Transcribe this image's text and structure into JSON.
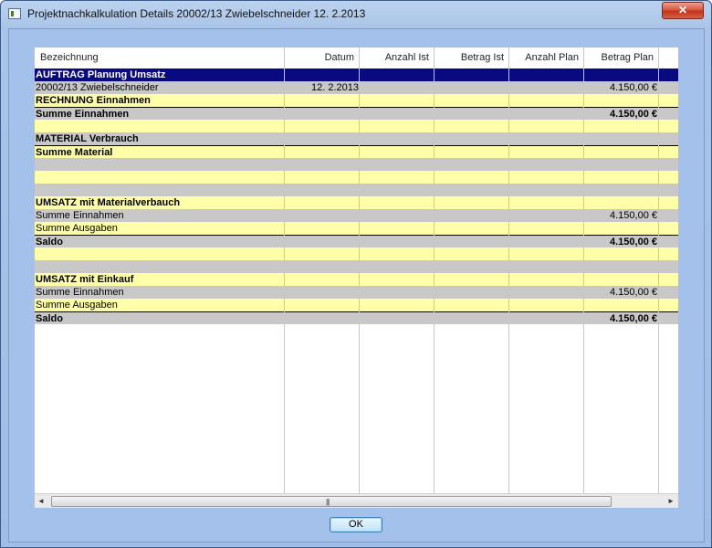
{
  "window": {
    "title": "Projektnachkalkulation Details 20002/13  Zwiebelschneider  12.  2.2013",
    "close_label": "✕",
    "ok_label": "OK"
  },
  "table": {
    "columns": [
      "Bezeichnung",
      "Datum",
      "Anzahl Ist",
      "Betrag Ist",
      "Anzahl Plan",
      "Betrag Plan"
    ],
    "rows": [
      {
        "style": "navy",
        "bold": true,
        "name": "AUFTRAG Planung Umsatz",
        "datum": "",
        "betrag_plan": ""
      },
      {
        "style": "gray",
        "bold": false,
        "name": "20002/13 Zwiebelschneider",
        "datum": "12.  2.2013",
        "betrag_plan": "4.150,00 €"
      },
      {
        "style": "yellow",
        "bold": true,
        "name": "RECHNUNG Einnahmen",
        "datum": "",
        "betrag_plan": ""
      },
      {
        "style": "gray",
        "bold": true,
        "name": "Summe Einnahmen",
        "datum": "",
        "betrag_plan": "4.150,00 €",
        "top_border": true
      },
      {
        "style": "yellow",
        "bold": false,
        "name": "",
        "datum": "",
        "betrag_plan": ""
      },
      {
        "style": "gray",
        "bold": true,
        "name": "MATERIAL Verbrauch",
        "datum": "",
        "betrag_plan": ""
      },
      {
        "style": "yellow",
        "bold": true,
        "name": "Summe Material",
        "datum": "",
        "betrag_plan": "",
        "top_border": true
      },
      {
        "style": "gray",
        "bold": false,
        "name": "",
        "datum": "",
        "betrag_plan": ""
      },
      {
        "style": "yellow",
        "bold": false,
        "name": "",
        "datum": "",
        "betrag_plan": ""
      },
      {
        "style": "gray",
        "bold": false,
        "name": "",
        "datum": "",
        "betrag_plan": ""
      },
      {
        "style": "yellow",
        "bold": true,
        "name": "UMSATZ mit Materialverbauch",
        "datum": "",
        "betrag_plan": ""
      },
      {
        "style": "gray",
        "bold": false,
        "name": "Summe Einnahmen",
        "datum": "",
        "betrag_plan": "4.150,00 €"
      },
      {
        "style": "yellow",
        "bold": false,
        "name": "Summe Ausgaben",
        "datum": "",
        "betrag_plan": ""
      },
      {
        "style": "gray",
        "bold": true,
        "name": "Saldo",
        "datum": "",
        "betrag_plan": "4.150,00 €",
        "top_border": true
      },
      {
        "style": "yellow",
        "bold": false,
        "name": "",
        "datum": "",
        "betrag_plan": ""
      },
      {
        "style": "gray",
        "bold": false,
        "name": "",
        "datum": "",
        "betrag_plan": ""
      },
      {
        "style": "yellow",
        "bold": true,
        "name": "UMSATZ mit Einkauf",
        "datum": "",
        "betrag_plan": ""
      },
      {
        "style": "gray",
        "bold": false,
        "name": "Summe Einnahmen",
        "datum": "",
        "betrag_plan": "4.150,00 €"
      },
      {
        "style": "yellow",
        "bold": false,
        "name": "Summe Ausgaben",
        "datum": "",
        "betrag_plan": ""
      },
      {
        "style": "gray",
        "bold": true,
        "name": "Saldo",
        "datum": "",
        "betrag_plan": "4.150,00 €",
        "top_border": true
      }
    ]
  },
  "scrollbar": {
    "left_arrow": "◄",
    "right_arrow": "►",
    "grip": "|||"
  },
  "colors": {
    "header_row": "#0a0a80",
    "row_yellow": "#ffffaa",
    "row_gray": "#c8c8c8",
    "window_frame": "#a3c1ea"
  }
}
